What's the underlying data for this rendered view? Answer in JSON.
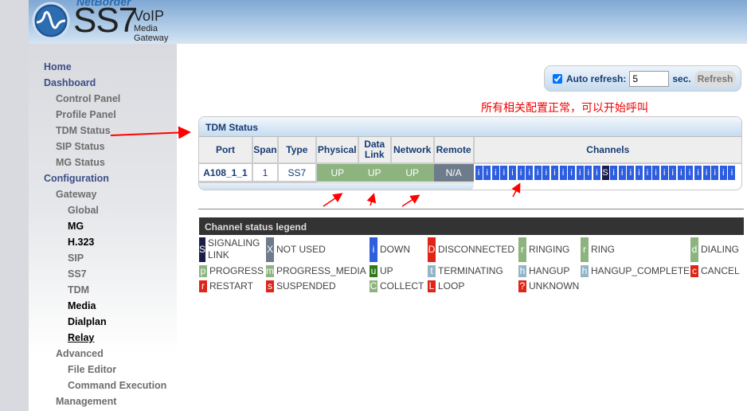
{
  "header": {
    "brand_top": "NetBorder",
    "brand_main": "SS7",
    "brand_voip": "VoIP",
    "brand_sub": "Media Gateway"
  },
  "sidebar": [
    {
      "label": "Home",
      "level": 1
    },
    {
      "label": "Dashboard",
      "level": 1
    },
    {
      "label": "Control Panel",
      "level": 2
    },
    {
      "label": "Profile Panel",
      "level": 2
    },
    {
      "label": "TDM Status",
      "level": 2
    },
    {
      "label": "SIP Status",
      "level": 2
    },
    {
      "label": "MG Status",
      "level": 2
    },
    {
      "label": "Configuration",
      "level": 1
    },
    {
      "label": "Gateway",
      "level": 2
    },
    {
      "label": "Global",
      "level": 3
    },
    {
      "label": "MG",
      "level": 3,
      "dark": true
    },
    {
      "label": "H.323",
      "level": 3,
      "dark": true
    },
    {
      "label": "SIP",
      "level": 3
    },
    {
      "label": "SS7",
      "level": 3
    },
    {
      "label": "TDM",
      "level": 3
    },
    {
      "label": "Media",
      "level": 3,
      "dark": true
    },
    {
      "label": "Dialplan",
      "level": 3,
      "dark": true
    },
    {
      "label": "Relay",
      "level": 3,
      "dark": true,
      "underline": true
    },
    {
      "label": "Advanced",
      "level": 2
    },
    {
      "label": "File Editor",
      "level": 3
    },
    {
      "label": "Command Execution",
      "level": 3
    },
    {
      "label": "Management",
      "level": 2
    }
  ],
  "refresh": {
    "checked": true,
    "label": "Auto refresh:",
    "value": "5",
    "unit": "sec.",
    "button": "Refresh"
  },
  "annotation": "所有相关配置正常，可以开始呼叫",
  "tdm": {
    "title": "TDM Status",
    "headers": {
      "port": "Port",
      "span": "Span",
      "type": "Type",
      "physical": "Physical",
      "datalink1": "Data",
      "datalink2": "Link",
      "network": "Network",
      "remote": "Remote",
      "channels": "Channels"
    },
    "row": {
      "port": "A108_1_1",
      "span": "1",
      "type": "SS7",
      "physical": "UP",
      "datalink": "UP",
      "network": "UP",
      "remote": "N/A"
    },
    "channels": [
      "i",
      "i",
      "i",
      "i",
      "i",
      "i",
      "i",
      "i",
      "i",
      "i",
      "i",
      "i",
      "i",
      "i",
      "i",
      "S",
      "i",
      "i",
      "i",
      "i",
      "i",
      "i",
      "i",
      "i",
      "i",
      "i",
      "i",
      "i",
      "i",
      "i",
      "i"
    ]
  },
  "legend": {
    "title": "Channel status legend",
    "items": [
      {
        "code": "S",
        "label": "SIGNALING LINK",
        "color": "#1a1d4a"
      },
      {
        "code": "X",
        "label": "NOT USED",
        "color": "#6e7b8b"
      },
      {
        "code": "i",
        "label": "DOWN",
        "color": "#2e5ee0"
      },
      {
        "code": "D",
        "label": "DISCONNECTED",
        "color": "#e02418"
      },
      {
        "code": "r",
        "label": "RINGING",
        "color": "#8db47f"
      },
      {
        "code": "r",
        "label": "RING",
        "color": "#8db47f"
      },
      {
        "code": "d",
        "label": "DIALING",
        "color": "#8db47f"
      },
      {
        "code": "p",
        "label": "PROGRESS",
        "color": "#8db47f"
      },
      {
        "code": "m",
        "label": "PROGRESS_MEDIA",
        "color": "#8db47f"
      },
      {
        "code": "u",
        "label": "UP",
        "color": "#2f7a18"
      },
      {
        "code": "t",
        "label": "TERMINATING",
        "color": "#93b5c6"
      },
      {
        "code": "h",
        "label": "HANGUP",
        "color": "#93b5c6"
      },
      {
        "code": "h",
        "label": "HANGUP_COMPLETE",
        "color": "#93b5c6"
      },
      {
        "code": "c",
        "label": "CANCEL",
        "color": "#e02418"
      },
      {
        "code": "r",
        "label": "RESTART",
        "color": "#e02418"
      },
      {
        "code": "s",
        "label": "SUSPENDED",
        "color": "#e02418"
      },
      {
        "code": "C",
        "label": "COLLECT",
        "color": "#8db47f"
      },
      {
        "code": "L",
        "label": "LOOP",
        "color": "#e02418"
      },
      {
        "code": "?",
        "label": "UNKNOWN",
        "color": "#e02418"
      }
    ]
  }
}
